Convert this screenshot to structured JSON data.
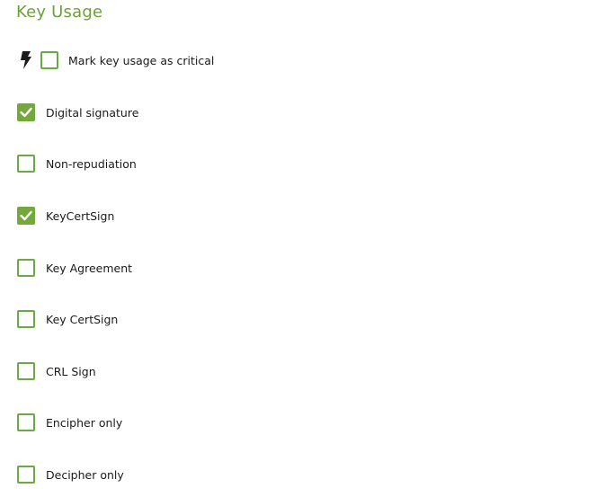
{
  "section": {
    "title": "Key Usage",
    "critical": {
      "icon": "lightning-bolt-icon",
      "label": "Mark key usage as critical",
      "checked": false
    }
  },
  "options": [
    {
      "label": "Digital signature",
      "checked": true
    },
    {
      "label": "Non-repudiation",
      "checked": false
    },
    {
      "label": "KeyCertSign",
      "checked": true
    },
    {
      "label": "Key Agreement",
      "checked": false
    },
    {
      "label": "Key CertSign",
      "checked": false
    },
    {
      "label": "CRL Sign",
      "checked": false
    },
    {
      "label": "Encipher only",
      "checked": false
    },
    {
      "label": "Decipher only",
      "checked": false
    }
  ],
  "colors": {
    "accent": "#6ba135",
    "checkbox_border": "#6aaa45",
    "checkbox_fill": "#73a83c"
  }
}
